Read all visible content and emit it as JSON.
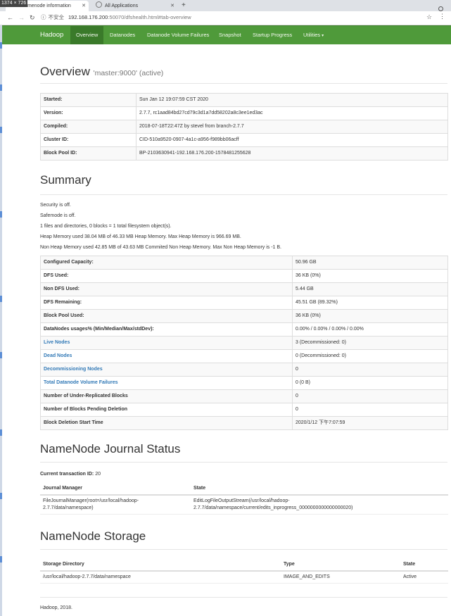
{
  "browser": {
    "dim_badge": "1374 × 726",
    "tabs": [
      {
        "label": "Namenode information",
        "active": true
      },
      {
        "label": "All Applications",
        "active": false
      }
    ],
    "new_tab": "+",
    "security_label": "不安全",
    "url_host": "192.168.176.200",
    "url_path": ":50070/dfshealth.html#tab-overview"
  },
  "navbar": {
    "brand": "Hadoop",
    "items": [
      "Overview",
      "Datanodes",
      "Datanode Volume Failures",
      "Snapshot",
      "Startup Progress",
      "Utilities"
    ],
    "active": "Overview",
    "accent": "#4f9a3a"
  },
  "overview": {
    "title": "Overview",
    "subtitle": "'master:9000' (active)",
    "rows": [
      {
        "key": "Started:",
        "value": "Sun Jan 12 19:07:59 CST 2020"
      },
      {
        "key": "Version:",
        "value": "2.7.7, rc1aad84bd27cd79c3d1a7dd58202a8c3ee1ed3ac"
      },
      {
        "key": "Compiled:",
        "value": "2018-07-18T22:47Z by stevel from branch-2.7.7"
      },
      {
        "key": "Cluster ID:",
        "value": "CID-510a9520-0907-4a1c-a956-f989bb06acff"
      },
      {
        "key": "Block Pool ID:",
        "value": "BP-2103630941-192.168.176.200-1578481255628"
      }
    ]
  },
  "summary": {
    "title": "Summary",
    "lines": [
      "Security is off.",
      "Safemode is off.",
      "1 files and directories, 0 blocks = 1 total filesystem object(s).",
      "Heap Memory used 38.04 MB of 46.33 MB Heap Memory. Max Heap Memory is 966.69 MB.",
      "Non Heap Memory used 42.85 MB of 43.63 MB Commited Non Heap Memory. Max Non Heap Memory is -1 B."
    ],
    "rows": [
      {
        "key": "Configured Capacity:",
        "value": "50.96 GB"
      },
      {
        "key": "DFS Used:",
        "value": "36 KB (0%)"
      },
      {
        "key": "Non DFS Used:",
        "value": "5.44 GB"
      },
      {
        "key": "DFS Remaining:",
        "value": "45.51 GB (89.32%)"
      },
      {
        "key": "Block Pool Used:",
        "value": "36 KB (0%)"
      },
      {
        "key": "DataNodes usages% (Min/Median/Max/stdDev):",
        "value": "0.00% / 0.00% / 0.00% / 0.00%"
      },
      {
        "key": "Live Nodes",
        "value": "3 (Decommissioned: 0)",
        "link": true
      },
      {
        "key": "Dead Nodes",
        "value": "0 (Decommissioned: 0)",
        "link": true
      },
      {
        "key": "Decommissioning Nodes",
        "value": "0",
        "link": true
      },
      {
        "key": "Total Datanode Volume Failures",
        "value": "0 (0 B)",
        "link": true
      },
      {
        "key": "Number of Under-Replicated Blocks",
        "value": "0"
      },
      {
        "key": "Number of Blocks Pending Deletion",
        "value": "0"
      },
      {
        "key": "Block Deletion Start Time",
        "value": "2020/1/12 下午7:07:59"
      }
    ]
  },
  "journal": {
    "title": "NameNode Journal Status",
    "txid_label": "Current transaction ID:",
    "txid": "20",
    "headers": [
      "Journal Manager",
      "State"
    ],
    "rows": [
      [
        "FileJournalManager(root=/usr/local/hadoop-\n2.7.7/data/namespace)",
        "EditLogFileOutputStream(/usr/local/hadoop-\n2.7.7/data/namespace/current/edits_inprogress_0000000000000000020)"
      ]
    ]
  },
  "storage": {
    "title": "NameNode Storage",
    "headers": [
      "Storage Directory",
      "Type",
      "State"
    ],
    "rows": [
      [
        "/usr/local/hadoop-2.7.7/data/namespace",
        "IMAGE_AND_EDITS",
        "Active"
      ]
    ]
  },
  "footer": "Hadoop, 2018."
}
